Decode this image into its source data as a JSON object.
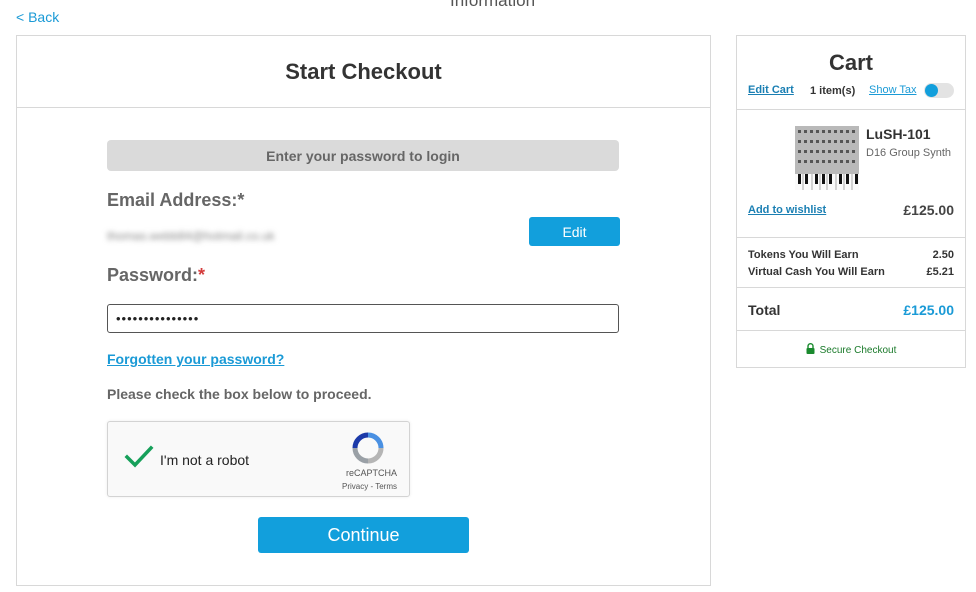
{
  "nav": {
    "back_label": "< Back",
    "heading_partial": "Information"
  },
  "checkout": {
    "title": "Start Checkout",
    "login_banner": "Enter your password to login",
    "email_label": "Email Address:*",
    "email_value": "thomas.webb84@hotmail.co.uk",
    "edit_button": "Edit",
    "password_label": "Password:",
    "password_required_mark": "*",
    "password_value": "•••••••••••••••",
    "forgot_link": "Forgotten your password?",
    "instruction": "Please check the box below to proceed.",
    "captcha": {
      "label": "I'm not a robot",
      "brand": "reCAPTCHA",
      "links": "Privacy - Terms",
      "checked": true
    },
    "continue_button": "Continue"
  },
  "cart": {
    "title": "Cart",
    "edit_cart": "Edit Cart",
    "item_count": "1 item(s)",
    "show_tax": "Show Tax",
    "show_tax_on": true,
    "product": {
      "name": "LuSH-101",
      "subtitle": "D16 Group Synth",
      "wishlist": "Add to wishlist",
      "price": "£125.00"
    },
    "rewards": [
      {
        "label": "Tokens You Will Earn",
        "value": "2.50"
      },
      {
        "label": "Virtual Cash You Will Earn",
        "value": "£5.21"
      }
    ],
    "total_label": "Total",
    "total_value": "£125.00",
    "secure_label": "Secure Checkout"
  },
  "colors": {
    "accent": "#129fdc",
    "link": "#1a9ad6",
    "required": "#d43c3c",
    "secure": "#1a7a2a"
  }
}
